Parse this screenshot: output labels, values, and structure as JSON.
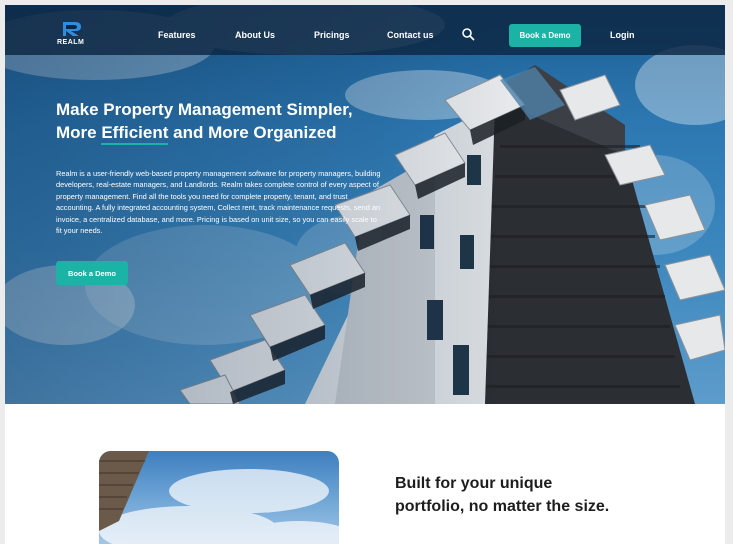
{
  "brand": {
    "name": "REALM"
  },
  "nav": {
    "links": [
      "Features",
      "About Us",
      "Pricings",
      "Contact us"
    ],
    "book_demo": "Book a Demo",
    "login": "Login"
  },
  "hero": {
    "title_part1": "Make Property Management Simpler, More ",
    "title_highlight": "Efficient",
    "title_part2": " and More Organized",
    "description": "Realm is a user-friendly web-based property management software for property managers, building developers, real-estate managers, and Landlords. Realm takes complete control of every aspect of property management. Find all the tools you need for complete property, tenant, and trust accounting. A fully integrated accounting system, Collect rent, track maintenance requests, send an invoice, a centralized database, and more. Pricing is based on unit size, so you can easily scale to fit your needs.",
    "cta": "Book a Demo"
  },
  "section2": {
    "heading": "Built for your unique portfolio, no matter the size."
  },
  "colors": {
    "accent": "#1ab3a6",
    "nav_bg": "#0c2642",
    "heading_text": "#1d1d1d"
  },
  "icons": {
    "search": "search-icon",
    "logo": "realm-logo-icon"
  }
}
